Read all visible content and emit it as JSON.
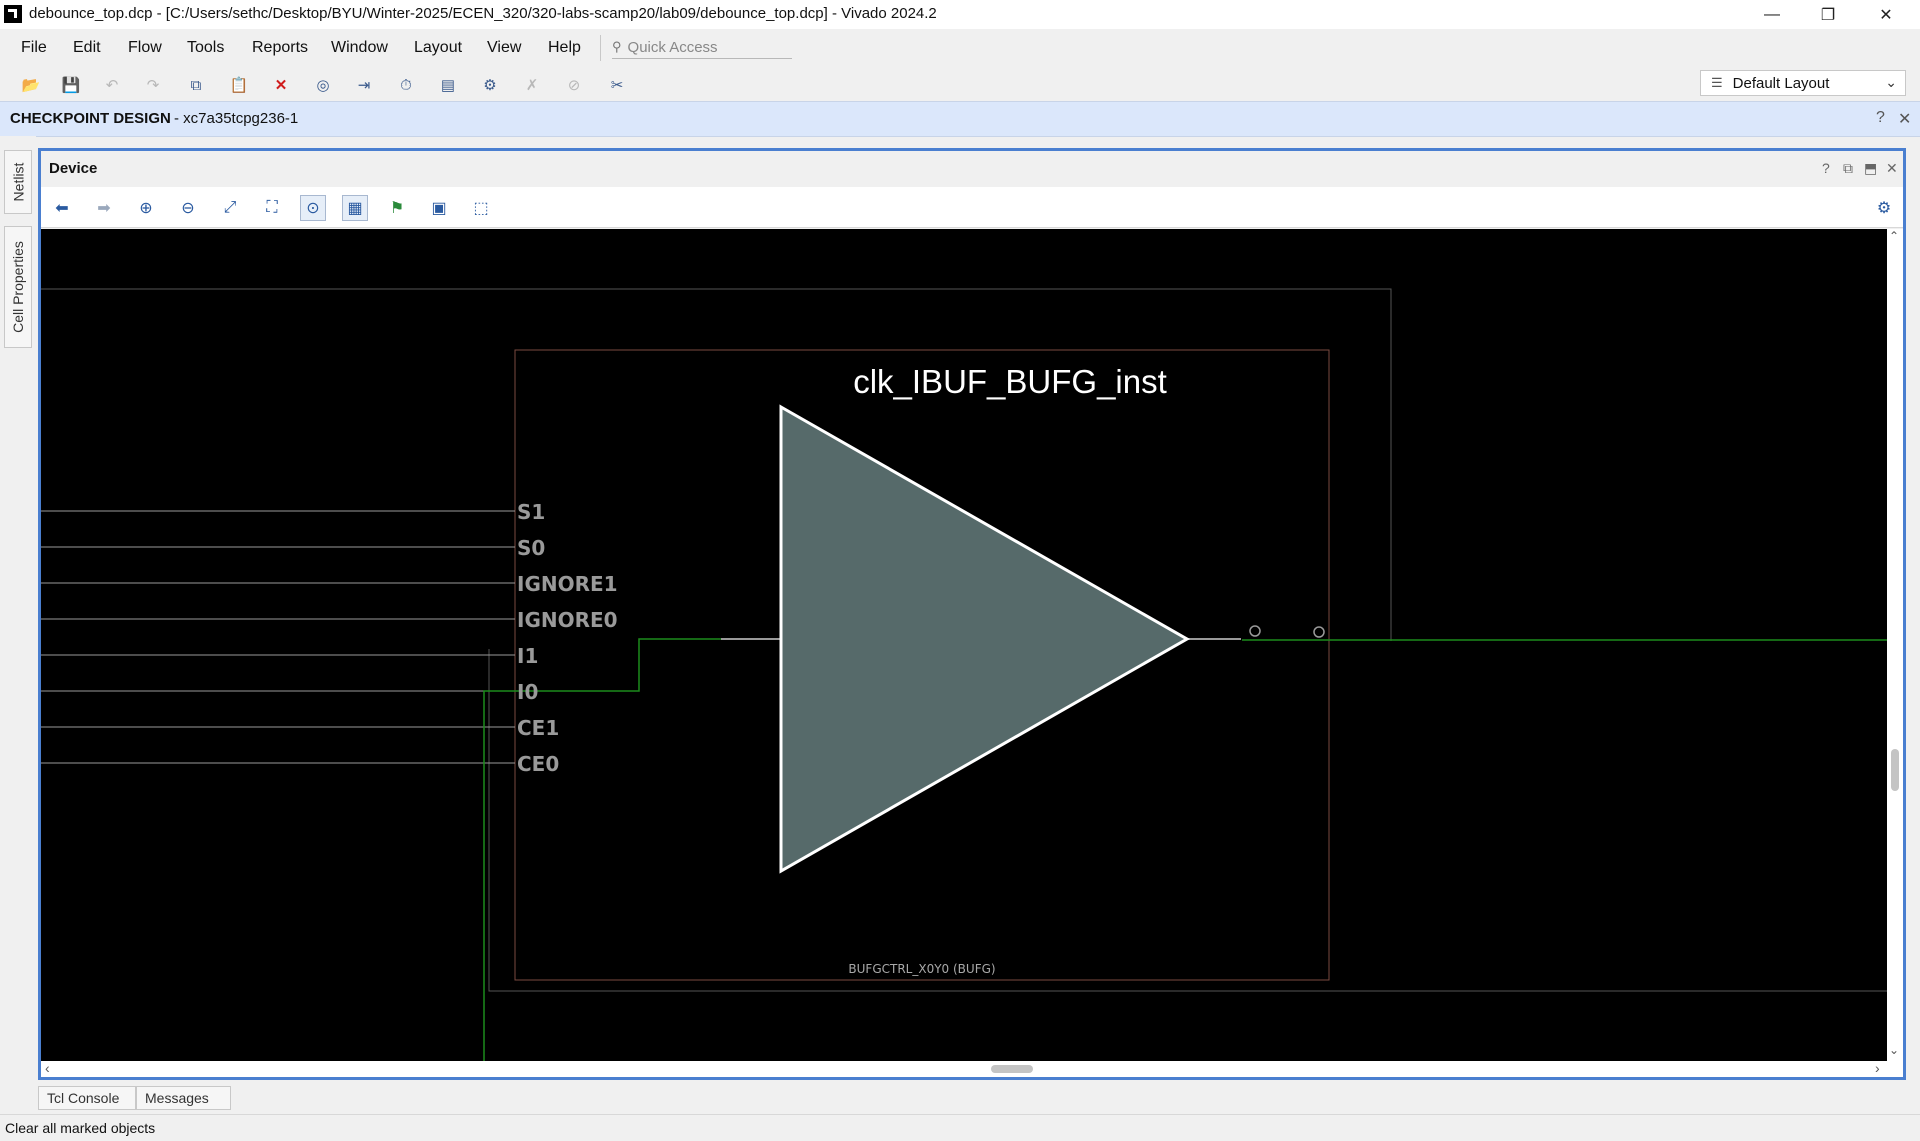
{
  "window": {
    "title": "debounce_top.dcp - [C:/Users/sethc/Desktop/BYU/Winter-2025/ECEN_320/320-labs-scamp20/lab09/debounce_top.dcp] - Vivado 2024.2",
    "minimize_glyph": "—",
    "restore_glyph": "❐",
    "close_glyph": "✕"
  },
  "menu": {
    "items": [
      "File",
      "Edit",
      "Flow",
      "Tools",
      "Reports",
      "Window",
      "Layout",
      "View",
      "Help"
    ],
    "quick_access_placeholder": "Quick Access"
  },
  "toolbar": {
    "icons": [
      {
        "name": "open-project-icon",
        "glyph": "📂",
        "enabled": true
      },
      {
        "name": "save-icon",
        "glyph": "💾",
        "enabled": false
      },
      {
        "name": "undo-icon",
        "glyph": "↶",
        "enabled": false
      },
      {
        "name": "redo-icon",
        "glyph": "↷",
        "enabled": false
      },
      {
        "name": "copy-icon",
        "glyph": "⧉",
        "enabled": true
      },
      {
        "name": "paste-icon",
        "glyph": "📋",
        "enabled": false
      },
      {
        "name": "delete-icon",
        "glyph": "✕",
        "enabled": true
      },
      {
        "name": "binoculars-icon",
        "glyph": "◎",
        "enabled": true
      },
      {
        "name": "run-icon",
        "glyph": "⇥",
        "enabled": true
      },
      {
        "name": "timer-icon",
        "glyph": "⏱",
        "enabled": true
      },
      {
        "name": "report-icon",
        "glyph": "▤",
        "enabled": true
      },
      {
        "name": "settings-icon",
        "glyph": "⚙",
        "enabled": true
      },
      {
        "name": "tools-disabled-icon",
        "glyph": "✗",
        "enabled": false
      },
      {
        "name": "probe-disabled-icon",
        "glyph": "⊘",
        "enabled": false
      },
      {
        "name": "cut-net-icon",
        "glyph": "✂",
        "enabled": true
      }
    ],
    "layout_select": "Default Layout"
  },
  "checkpoint": {
    "title": "CHECKPOINT DESIGN",
    "part": "- xc7a35tcpg236-1",
    "help": "?",
    "close": "✕"
  },
  "side_tabs": [
    "Netlist",
    "Cell Properties"
  ],
  "device": {
    "title": "Device",
    "header_buttons": [
      "?",
      "⧉",
      "⬒",
      "✕"
    ],
    "tools": [
      {
        "name": "back-icon",
        "glyph": "⬅",
        "toggled": false
      },
      {
        "name": "forward-icon",
        "glyph": "➡",
        "toggled": false
      },
      {
        "name": "zoom-in-icon",
        "glyph": "⊕",
        "toggled": false
      },
      {
        "name": "zoom-out-icon",
        "glyph": "⊖",
        "toggled": false
      },
      {
        "name": "zoom-fit-icon",
        "glyph": "⤢",
        "toggled": false
      },
      {
        "name": "zoom-selection-icon",
        "glyph": "⛶",
        "toggled": false
      },
      {
        "name": "auto-fit-icon",
        "glyph": "⊙",
        "toggled": true
      },
      {
        "name": "routing-resources-icon",
        "glyph": "▦",
        "toggled": true
      },
      {
        "name": "add-pblock-icon",
        "glyph": "⚑",
        "toggled": false
      },
      {
        "name": "layers-icon",
        "glyph": "▣",
        "toggled": false
      },
      {
        "name": "select-area-icon",
        "glyph": "⬚",
        "toggled": false
      }
    ],
    "settings_glyph": "⚙",
    "cell": {
      "instance_name": "clk_IBUF_BUFG_inst",
      "site_label": "BUFGCTRL_X0Y0 (BUFG)",
      "pins": [
        "S1",
        "S0",
        "IGNORE1",
        "IGNORE0",
        "I1",
        "I0",
        "CE1",
        "CE0"
      ]
    },
    "colors": {
      "background": "#000000",
      "buffer_fill": "#566a6a",
      "buffer_stroke": "#ffffff",
      "routed_net": "#1c8c1c",
      "site_outline": "#7a4a40",
      "tile_outline": "#555555",
      "pin_wire": "#9a9a9a"
    }
  },
  "bottom_tabs": [
    "Tcl Console",
    "Messages"
  ],
  "status": "Clear all marked objects"
}
